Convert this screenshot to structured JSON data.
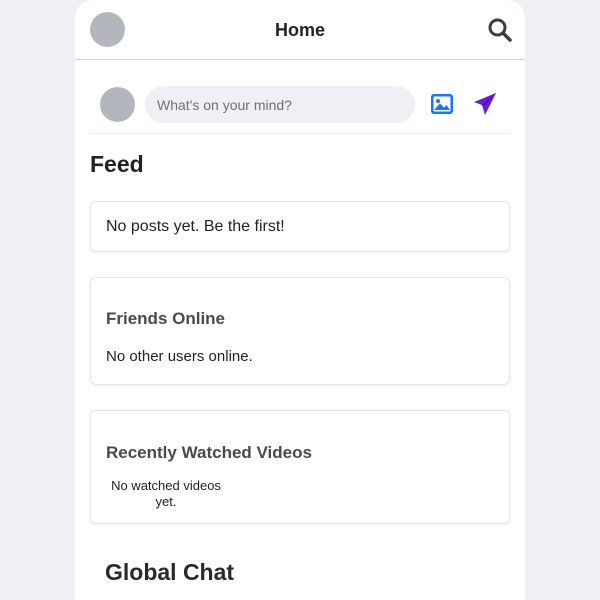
{
  "header": {
    "title": "Home",
    "search_icon": "search-icon"
  },
  "composer": {
    "placeholder": "What's on your mind?",
    "image_icon": "image-icon",
    "send_icon": "send-icon"
  },
  "feed": {
    "heading": "Feed",
    "empty_message": "No posts yet. Be the first!"
  },
  "friends_online": {
    "title": "Friends Online",
    "empty_message": "No other users online."
  },
  "recent_videos": {
    "title": "Recently Watched Videos",
    "empty_message": "No watched videos yet."
  },
  "global_chat": {
    "heading": "Global Chat"
  },
  "colors": {
    "page_background": "#eff0f4",
    "image_icon": "#1877f2",
    "send_icon": "#6a1be0",
    "avatar_placeholder": "#b3b6bd"
  }
}
